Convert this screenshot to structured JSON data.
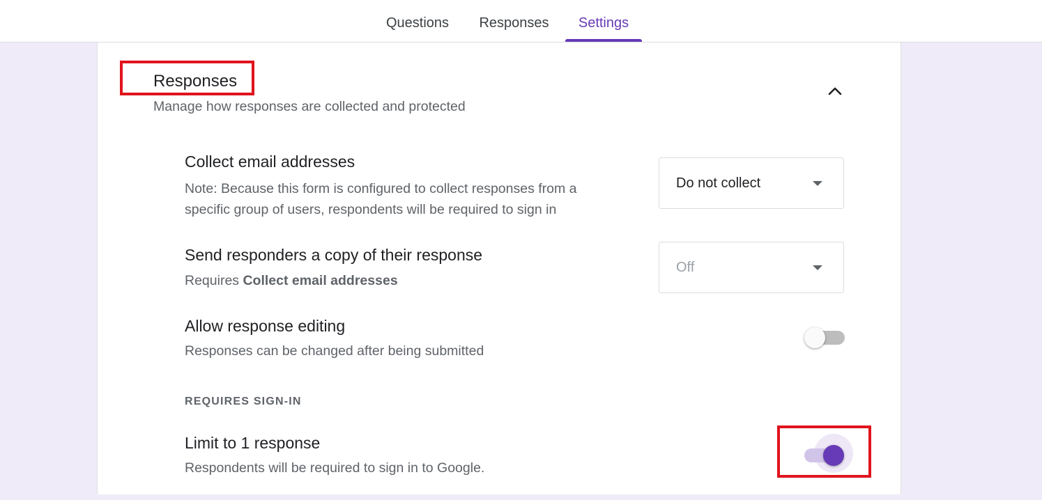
{
  "tabs": [
    {
      "label": "Questions",
      "active": false
    },
    {
      "label": "Responses",
      "active": false
    },
    {
      "label": "Settings",
      "active": true
    }
  ],
  "section": {
    "title": "Responses",
    "subtitle": "Manage how responses are collected and protected",
    "expanded": true,
    "collapse_icon": "chevron-up-icon"
  },
  "settings": {
    "collect_email": {
      "title": "Collect email addresses",
      "note_line1": "Note: Because this form is configured to collect responses from a",
      "note_line2": "specific group of users, respondents will be required to sign in",
      "value": "Do not collect"
    },
    "send_copy": {
      "title": "Send responders a copy of their response",
      "desc_prefix": "Requires ",
      "desc_bold": "Collect email addresses",
      "value": "Off",
      "disabled": true
    },
    "allow_editing": {
      "title": "Allow response editing",
      "desc": "Responses can be changed after being submitted",
      "on": false
    },
    "group_label": "REQUIRES SIGN-IN",
    "limit_one": {
      "title": "Limit to 1 response",
      "desc": "Respondents will be required to sign in to Google.",
      "on": true
    }
  },
  "colors": {
    "accent": "#673ab7",
    "background": "#f0ebf8",
    "highlight": "#e0141e"
  }
}
